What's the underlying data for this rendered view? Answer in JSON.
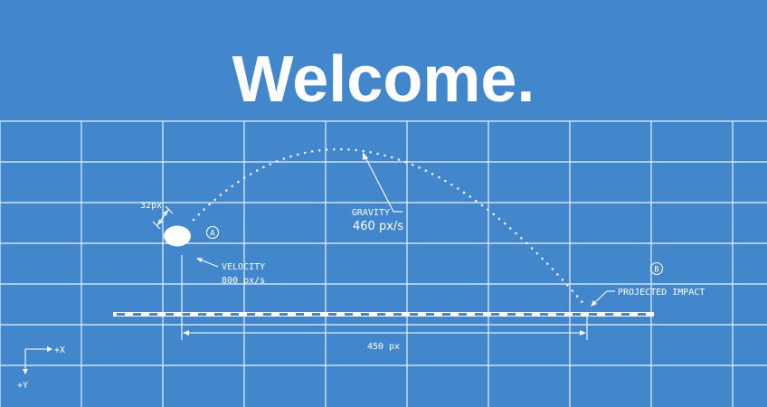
{
  "title": "Welcome.",
  "colors": {
    "background": "#4287cc",
    "grid": "#ffffff",
    "foreground": "#ffffff"
  },
  "annotations": {
    "diameter": "32px",
    "start_marker": "A",
    "end_marker": "B",
    "velocity_label": "VELOCITY",
    "velocity_value": "800 px/s",
    "gravity_label": "GRAVITY",
    "gravity_value": "460 px/s",
    "impact_label": "PROJECTED IMPACT",
    "distance_label": "450 px"
  },
  "axes": {
    "x_label": "+X",
    "y_label": "+Y"
  }
}
